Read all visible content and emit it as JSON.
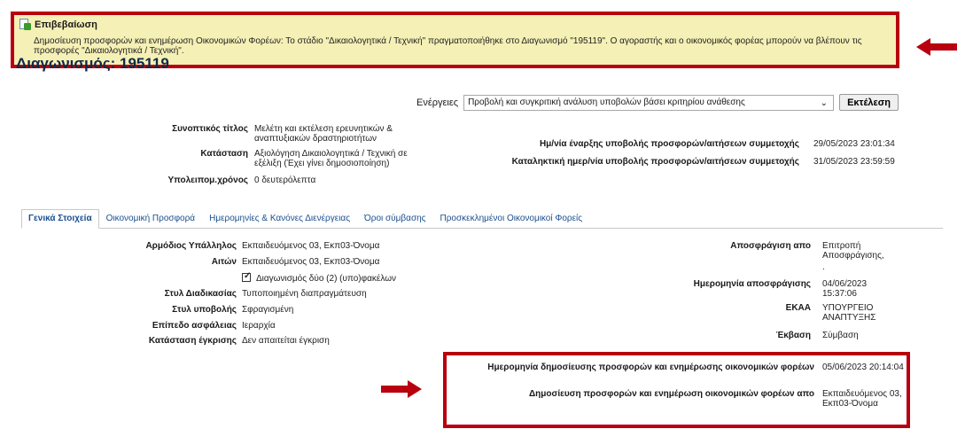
{
  "confirm": {
    "title": "Επιβεβαίωση",
    "icon": "confirm-page-icon",
    "message": "Δημοσίευση προσφορών και ενημέρωση Οικονομικών Φορέων: Το στάδιο \"Δικαιολογητικά / Τεχνική\" πραγματοποιήθηκε στο Διαγωνισμό \"195119\". Ο αγοραστής και ο οικονομικός φορέας μπορούν να βλέπουν τις προσφορές \"Δικαιολογητικά / Τεχνική\"."
  },
  "page_title": "Διαγωνισμός: 195119",
  "actions": {
    "label": "Ενέργειες",
    "selected": "Προβολή και συγκριτική ανάλυση υποβολών βάσει κριτηρίου ανάθεσης",
    "button": "Εκτέλεση"
  },
  "summary": {
    "short_title_label": "Συνοπτικός τίτλος",
    "short_title_value": "Μελέτη και εκτέλεση ερευνητικών & αναπτυξιακών δραστηριοτήτων",
    "status_label": "Κατάσταση",
    "status_value": "Αξιολόγηση Δικαιολογητικά / Τεχνική σε εξέλιξη (Έχει γίνει δημοσιοποίηση)",
    "remaining_label": "Υπολειπομ.χρόνος",
    "remaining_value": "0 δευτερόλεπτα",
    "start_label": "Ημ/νία έναρξης υποβολής προσφορών/αιτήσεων συμμετοχής",
    "start_value": "29/05/2023 23:01:34",
    "end_label": "Καταληκτική ημερ/νία υποβολής προσφορών/αιτήσεων συμμετοχής",
    "end_value": "31/05/2023 23:59:59"
  },
  "tabs": [
    "Γενικά Στοιχεία",
    "Οικονομική Προσφορά",
    "Ημερομηνίες & Κανόνες Διενέργειας",
    "Όροι σύμβασης",
    "Προσκεκλημένοι Οικονομικοί Φορείς"
  ],
  "general": {
    "officer_label": "Αρμόδιος Υπάλληλος",
    "officer_value": "Εκπαιδευόμενος 03, Εκπ03-Όνομα",
    "requester_label": "Αιτών",
    "requester_value": "Εκπαιδευόμενος 03, Εκπ03-Όνομα",
    "two_envelopes": "Διαγωνισμός δύο (2) (υπο)φακέλων",
    "procedure_label": "Στυλ Διαδικασίας",
    "procedure_value": "Τυποποιημένη διαπραγμάτευση",
    "submission_label": "Στυλ υποβολής",
    "submission_value": "Σφραγισμένη",
    "security_label": "Επίπεδο ασφάλειας",
    "security_value": "Ιεραρχία",
    "approval_label": "Κατάσταση έγκρισης",
    "approval_value": "Δεν απαιτείται έγκριση",
    "unseal_by_label": "Αποσφράγιση απο",
    "unseal_by_value": "Επιτροπή Αποσφράγισης,",
    "unseal_by_extra": ".",
    "unseal_date_label": "Ημερομηνία αποσφράγισης",
    "unseal_date_value": "04/06/2023 15:37:06",
    "ekaa_label": "ΕΚΑΑ",
    "ekaa_value": "ΥΠΟΥΡΓΕΙΟ ΑΝΑΠΤΥΞΗΣ",
    "outcome_label": "Έκβαση",
    "outcome_value": "Σύμβαση",
    "publish_date_label": "Ημερομηνία δημοσίευσης προσφορών και ενημέρωσης οικονομικών φορέων",
    "publish_date_value": "05/06/2023 20:14:04",
    "publish_by_label": "Δημοσίευση προσφορών και ενημέρωση οικονομικών φορέων απο",
    "publish_by_value": "Εκπαιδευόμενος 03, Εκπ03-Όνομα"
  },
  "colors": {
    "highlight_red": "#b8000e",
    "confirm_bg": "#f5f0b5",
    "link_blue": "#1a4f8f",
    "title_navy": "#0d2a4a"
  }
}
